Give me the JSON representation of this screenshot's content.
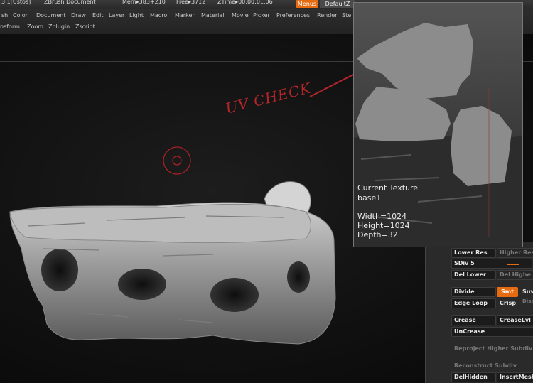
{
  "title_bar": {
    "version": "3.1[Ustos]",
    "doc": "ZBrush Document",
    "mem": "Mem▸383+210",
    "free": "Free▸3712",
    "ztime": "ZTime▸00:00:01.06",
    "menus_label": "Menus",
    "default_label": "DefaultZ"
  },
  "menu_row1": [
    "sh",
    "Color",
    "Document",
    "Draw",
    "Edit",
    "Layer",
    "Light",
    "Macro",
    "Marker",
    "Material",
    "Movie",
    "Picker",
    "Preferences",
    "Render",
    "Ste"
  ],
  "menu_row2": [
    "nsform",
    "Zoom",
    "Zplugin",
    "Zscript"
  ],
  "annotation": "UV CHECK",
  "texture_panel": {
    "current_texture": "Current Texture",
    "name": "base1",
    "width": "Width=1024",
    "height": "Height=1024",
    "depth": "Depth=32"
  },
  "geometry": {
    "lower_res": "Lower Res",
    "higher_res": "Higher Res",
    "sdiv": "SDiv 5",
    "del_lower": "Del Lower",
    "del_higher": "Del Highe",
    "divide": "Divide",
    "smt": "Smt",
    "suv": "Suv",
    "edge_loop": "Edge Loop",
    "crisp": "Crisp",
    "disp": "Disp",
    "crease": "Crease",
    "crease_lvl": "CreaseLvl",
    "uncrease": "UnCrease",
    "reproject": "Reproject Higher Subdiv",
    "reconstruct": "Reconstruct Subdiv",
    "del_hidden": "DelHidden",
    "insert_mesh": "InsertMesh"
  },
  "colors": {
    "accent": "#e56a10",
    "annotation": "#b3262a"
  }
}
